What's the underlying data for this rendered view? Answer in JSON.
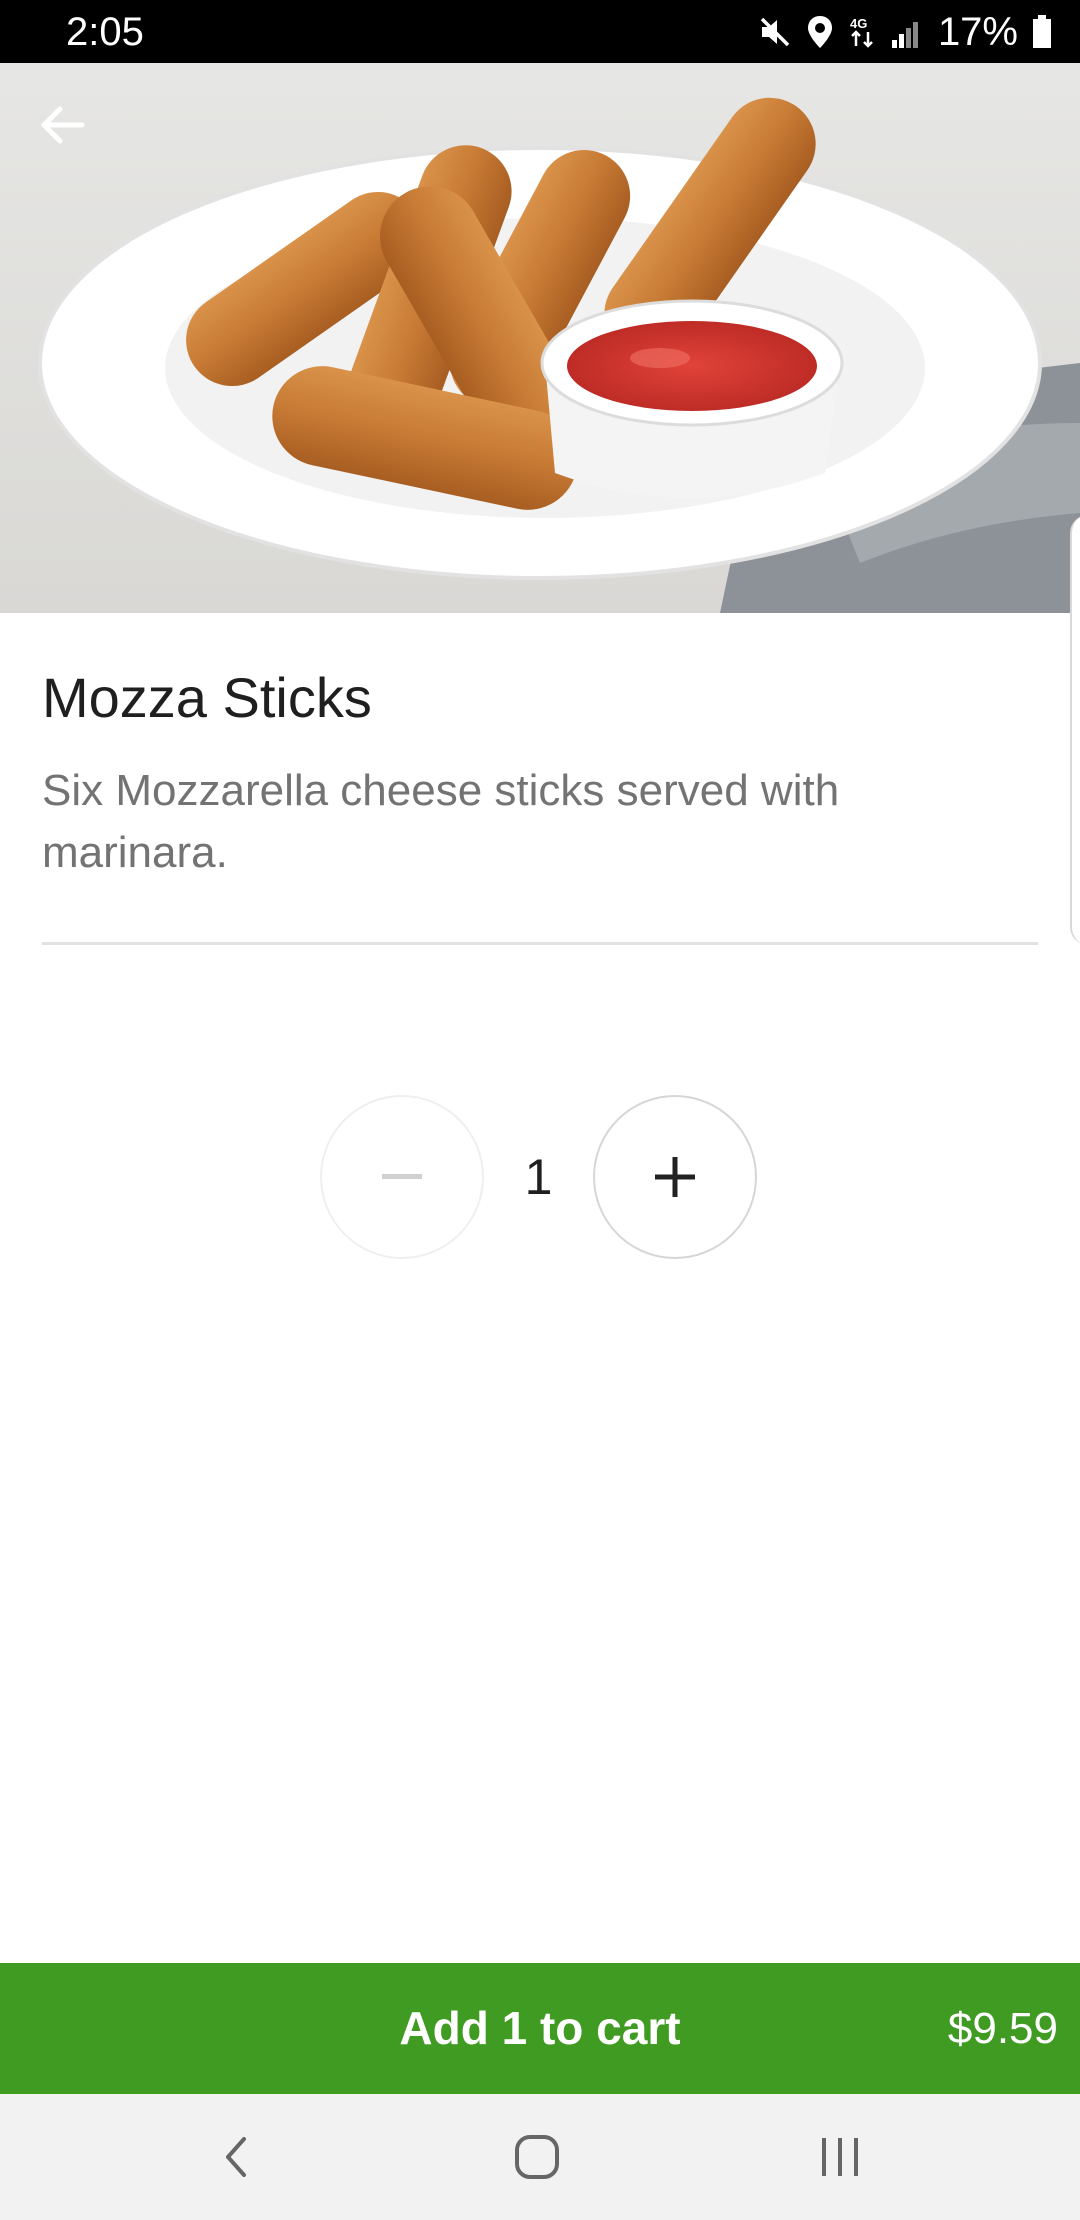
{
  "status_bar": {
    "time": "2:05",
    "battery_percent": "17%",
    "icons": [
      "mute-icon",
      "location-icon",
      "data-transfer-icon",
      "signal-icon",
      "battery-icon"
    ]
  },
  "hero": {
    "image": "mozzarella-sticks-photo",
    "back_icon": "arrow-left-icon"
  },
  "item": {
    "title": "Mozza Sticks",
    "description": "Six Mozzarella cheese sticks served with marinara."
  },
  "quantity": {
    "value": "1",
    "decrement_icon": "minus-icon",
    "increment_icon": "plus-icon"
  },
  "cart": {
    "label": "Add 1 to cart",
    "price": "$9.59",
    "color": "#3f9b22"
  },
  "nav": {
    "buttons": [
      "back-nav-icon",
      "home-nav-icon",
      "recents-nav-icon"
    ]
  }
}
